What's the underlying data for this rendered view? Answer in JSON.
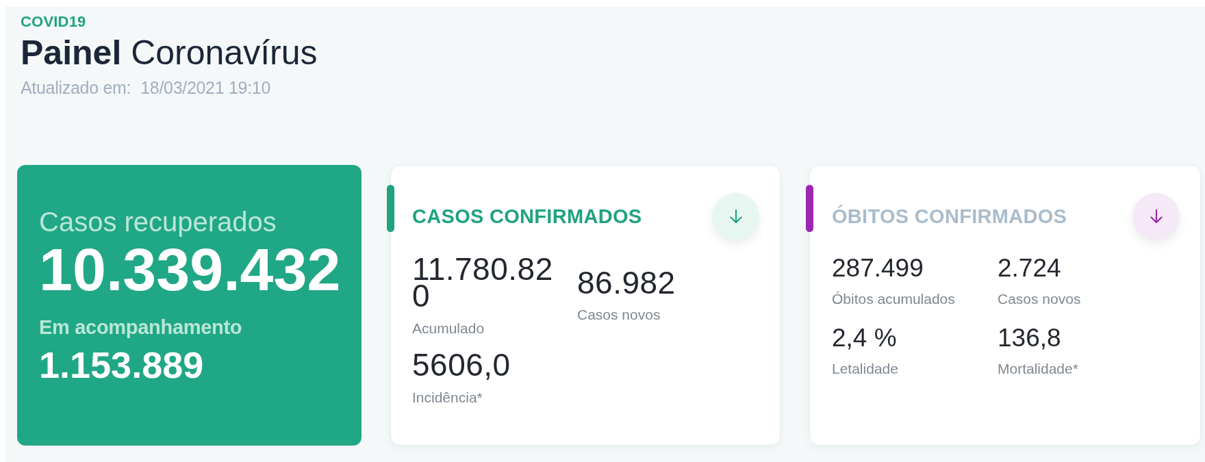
{
  "header": {
    "tag": "COVID19",
    "title": "**Painel** Coronavírus",
    "updated_label": "Atualizado em:",
    "updated_at": "18/03/2021 19:10"
  },
  "cards": [
    {
      "kind": "highlight",
      "label": "Casos recuperados",
      "value": "10.339.432",
      "secondary_label": "Em acompanhamento",
      "secondary_value": "1.153.889"
    },
    {
      "kind": "large",
      "title": "CASOS CONFIRMADOS",
      "color": "#1fa381",
      "title_accent": true,
      "stats": [
        {
          "value": "11.780.820",
          "label": "Acumulado"
        },
        {
          "value": "86.982",
          "label": "Casos novos"
        },
        {
          "value": "5606,0",
          "label": "Incidência*"
        }
      ]
    },
    {
      "kind": "compact",
      "title": "ÓBITOS CONFIRMADOS",
      "color": "#9c27b0",
      "title_accent": false,
      "stats": [
        {
          "value": "287.499",
          "label": "Óbitos acumulados"
        },
        {
          "value": "2.724",
          "label": "Casos novos"
        },
        {
          "value": "2,4 %",
          "label": "Letalidade"
        },
        {
          "value": "136,8",
          "label": "Mortalidade*"
        }
      ]
    }
  ]
}
